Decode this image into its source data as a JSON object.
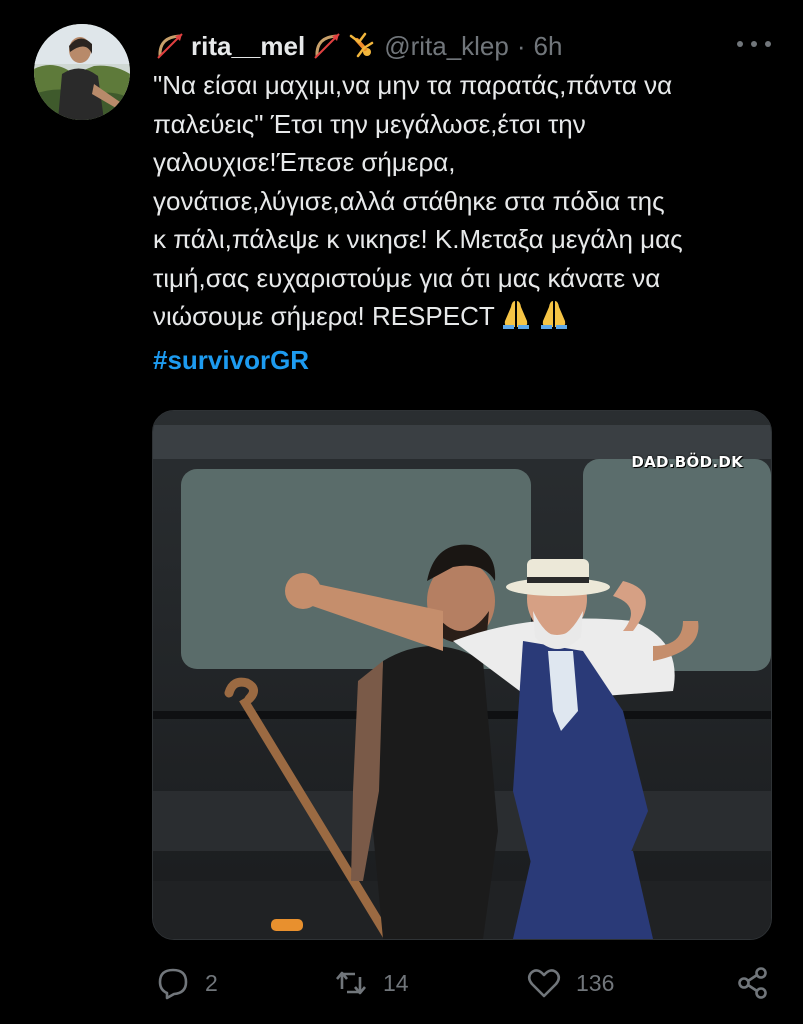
{
  "tweet": {
    "display_name": "rita__mel",
    "handle": "@rita_klep",
    "separator": "·",
    "time": "6h",
    "name_emojis_before": [
      "bow-and-arrow-emoji"
    ],
    "name_emojis_after": [
      "bow-and-arrow-emoji",
      "cartwheel-emoji"
    ],
    "text_lines": [
      "\"Να είσαι μαχιμι,να μην τα παρατάς,πάντα να",
      "παλεύεις\" Έτσι την μεγάλωσε,έτσι την",
      "γαλουχισε!Έπεσε σήμερα,",
      "γονάτισε,λύγισε,αλλά στάθηκε στα πόδια της",
      "κ πάλι,πάλεψε κ νικησε! Κ.Μεταξα μεγάλη μας",
      "τιμή,σας ευχαριστούμε για ότι μας κάνατε να",
      "νιώσουμε σήμερα! RESPECT"
    ],
    "text_trailing_emojis": [
      "folded-hands-emoji",
      "folded-hands-emoji"
    ],
    "hashtag": "#survivorGR",
    "media": {
      "watermark": "DAD.BÖD.DK"
    },
    "actions": {
      "reply_count": "2",
      "retweet_count": "14",
      "like_count": "136"
    }
  },
  "colors": {
    "background": "#000000",
    "text": "#e7e9ea",
    "secondary": "#71767b",
    "link": "#1d9bf0"
  }
}
